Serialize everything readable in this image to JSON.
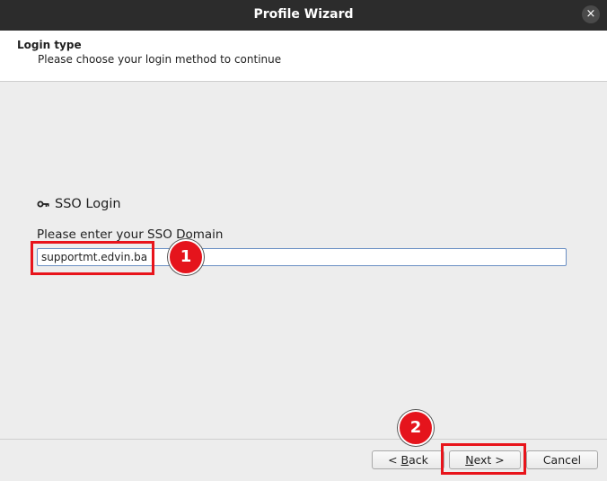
{
  "window": {
    "title": "Profile Wizard",
    "close_glyph": "×"
  },
  "header": {
    "title": "Login type",
    "subtitle": "Please choose your login method to continue"
  },
  "section": {
    "icon": "key-icon",
    "label": "SSO Login"
  },
  "form": {
    "prompt": "Please enter your SSO Domain",
    "domain_value": "supportmt.edvin.ba"
  },
  "annotations": {
    "callout1": "1",
    "callout2": "2",
    "highlight_color": "#e8141b"
  },
  "buttons": {
    "back_prefix": "< ",
    "back_mnemonic": "B",
    "back_rest": "ack",
    "next_mnemonic": "N",
    "next_rest": "ext >",
    "cancel": "Cancel"
  }
}
